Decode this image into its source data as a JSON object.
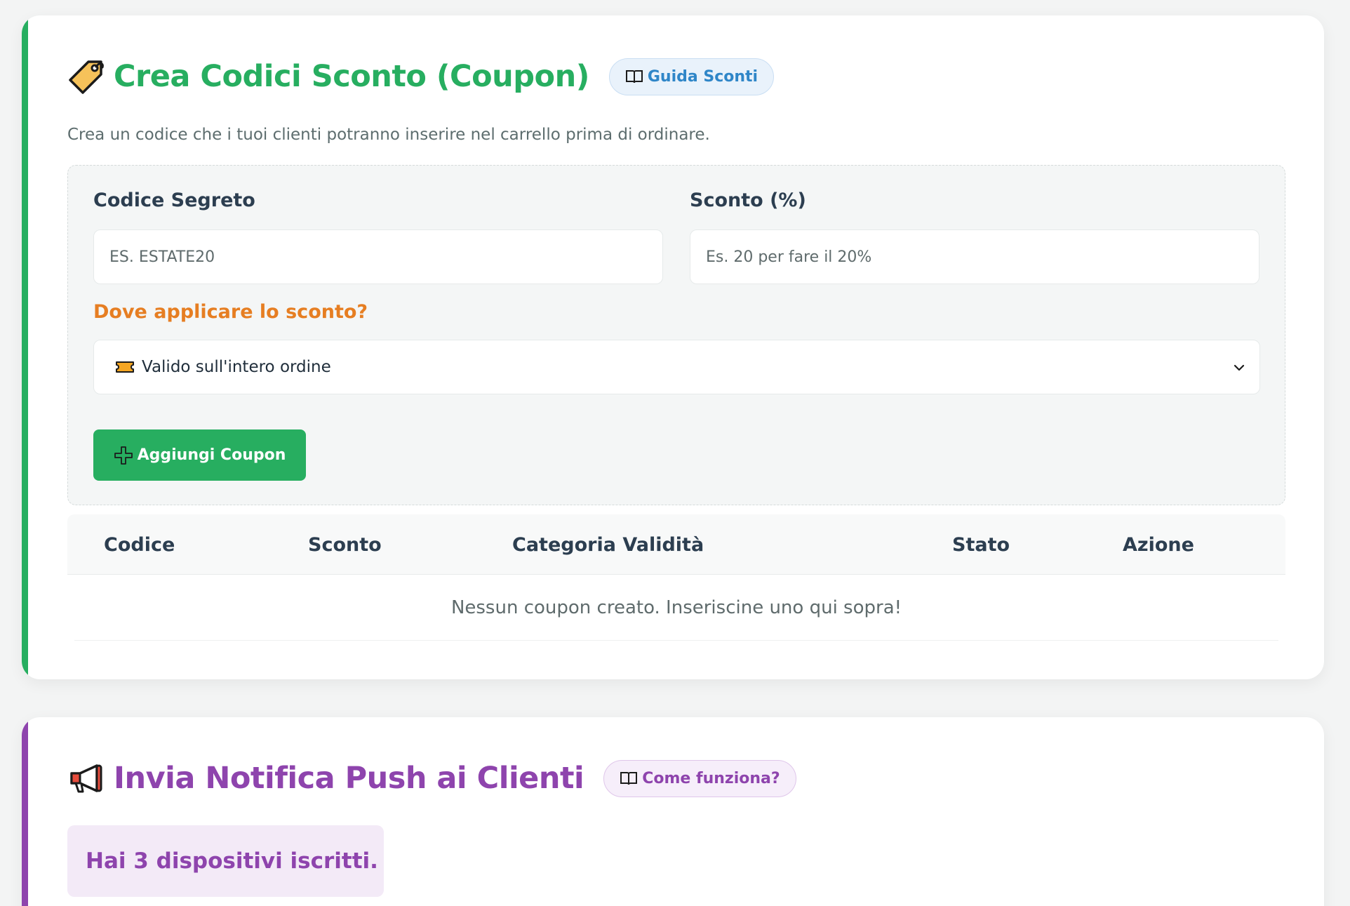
{
  "coupon_section": {
    "title": "Crea Codici Sconto (Coupon)",
    "title_icon": "price-tag-icon",
    "guide_button": "Guida Sconti",
    "guide_icon": "open-book-icon",
    "subtitle": "Crea un codice che i tuoi clienti potranno inserire nel carrello prima di ordinare.",
    "accent_color": "#27ae60",
    "form": {
      "code_label": "Codice Segreto",
      "code_placeholder": "ES. ESTATE20",
      "code_value": "",
      "discount_label": "Sconto (%)",
      "discount_placeholder": "Es. 20 per fare il 20%",
      "discount_value": "",
      "apply_label": "Dove applicare lo sconto?",
      "apply_selected": "Valido sull'intero ordine",
      "apply_icon": "ticket-icon",
      "add_button": "Aggiungi Coupon",
      "add_icon": "plus-icon"
    },
    "table": {
      "columns": [
        "Codice",
        "Sconto",
        "Categoria Validità",
        "Stato",
        "Azione"
      ],
      "rows": [],
      "empty_message": "Nessun coupon creato. Inseriscine uno qui sopra!"
    }
  },
  "push_section": {
    "title": "Invia Notifica Push ai Clienti",
    "title_icon": "megaphone-icon",
    "guide_button": "Come funziona?",
    "guide_icon": "open-book-icon",
    "accent_color": "#8e44ad",
    "devices_text": "Hai 3 dispositivi iscritti."
  }
}
